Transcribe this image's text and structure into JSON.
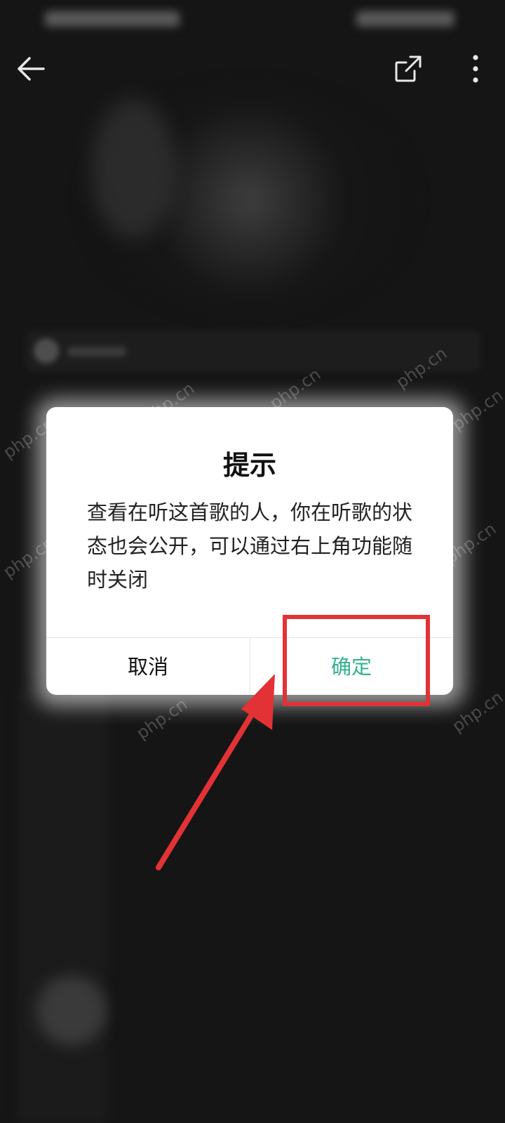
{
  "top_bar": {
    "back_icon": "arrow-left-icon",
    "share_icon": "share-external-icon",
    "more_icon": "more-vertical-icon"
  },
  "watermark_text": "php.cn",
  "dialog": {
    "title": "提示",
    "message": "查看在听这首歌的人，你在听歌的状态也会公开，可以通过右上角功能随时关闭",
    "cancel_label": "取消",
    "confirm_label": "确定",
    "confirm_color": "#31b28e"
  },
  "annotation": {
    "highlight_color": "#e33236",
    "arrow_color": "#e33236"
  }
}
